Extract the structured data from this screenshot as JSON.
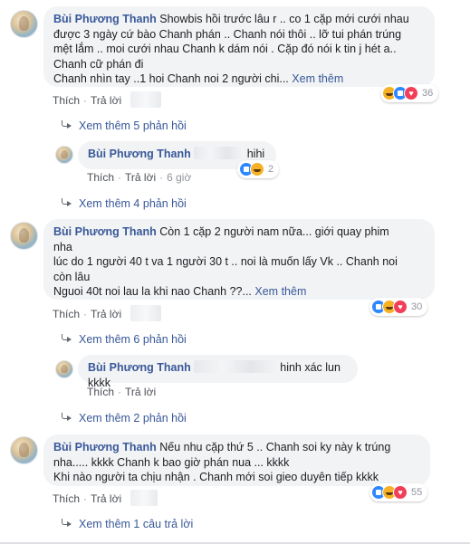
{
  "comments": [
    {
      "name": "Bùi Phương Thanh",
      "text_l1": "Showbis hồi trước lâu r .. co 1 cặp mới cưới nhau",
      "text_l2": "được 3 ngày cứ bào Chanh phán .. Chanh nói thôi .. lỡ tui phán trúng",
      "text_l3": "mệt lắm .. moi cưới nhau Chanh k dám nói . Cặp đó nói k tin j hét a..",
      "text_l4": "Chanh cữ phán đi",
      "text_l5": "Chanh nhìn tay ..1 hoi Chanh noi 2 người chi...",
      "see_more": "Xem thêm",
      "like": "Thích",
      "reply": "Trả lời",
      "reaction_count": "36",
      "replies_link": "Xem thêm 5 phản hồi"
    },
    {
      "name": "Bùi Phương Thanh",
      "text": "hihi",
      "like": "Thích",
      "reply": "Trả lời",
      "time": "6 giờ",
      "reaction_count": "2",
      "replies_link": "Xem thêm 4 phản hồi"
    },
    {
      "name": "Bùi Phương Thanh",
      "text_l1": "Còn 1 cặp 2 người nam nữa... giới quay phim",
      "text_l2": "nha",
      "text_l3": "lúc do 1 người 40 t va 1 người 30 t .. noi là muốn lấy Vk .. Chanh noi",
      "text_l4": "còn lâu",
      "text_l5": "Nguoi 40t noi lau la khi nao Chanh ??...",
      "see_more": "Xem thêm",
      "like": "Thích",
      "reply": "Trả lời",
      "reaction_count": "30",
      "replies_link": "Xem thêm 6 phản hồi"
    },
    {
      "name": "Bùi Phương Thanh",
      "text": "hinh xác lun kkkk",
      "like": "Thích",
      "reply": "Trả lời",
      "replies_link": "Xem thêm 2 phản hồi"
    },
    {
      "name": "Bùi Phương Thanh",
      "text_l1": "Nếu nhu cặp thứ 5 .. Chanh soi ky này k trúng",
      "text_l2": "nha..... kkkk Chanh k bao giờ phán nua ... kkkk",
      "text_l3": "Khi nào người ta chịu nhận . Chanh mới soi gieo duyên tiếp kkkk",
      "like": "Thích",
      "reply": "Trả lời",
      "reaction_count": "55",
      "replies_link": "Xem thêm 1 câu trả lời"
    }
  ]
}
